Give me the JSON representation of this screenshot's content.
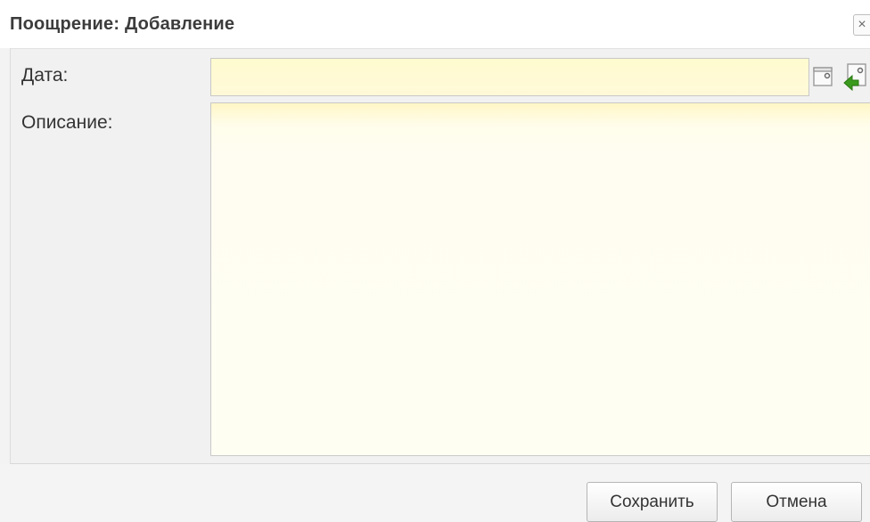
{
  "window": {
    "title": "Поощрение: Добавление",
    "close_icon": "×"
  },
  "form": {
    "date_label": "Дата:",
    "date_value": "",
    "description_label": "Описание:",
    "description_value": ""
  },
  "icons": {
    "calendar": "calendar-icon",
    "today": "today-arrow-icon",
    "close": "close-icon"
  },
  "footer": {
    "save_label": "Сохранить",
    "cancel_label": "Отмена"
  },
  "colors": {
    "field_background": "#fffcd9",
    "panel_background": "#f1f1f1",
    "today_arrow": "#3a9a1d"
  }
}
